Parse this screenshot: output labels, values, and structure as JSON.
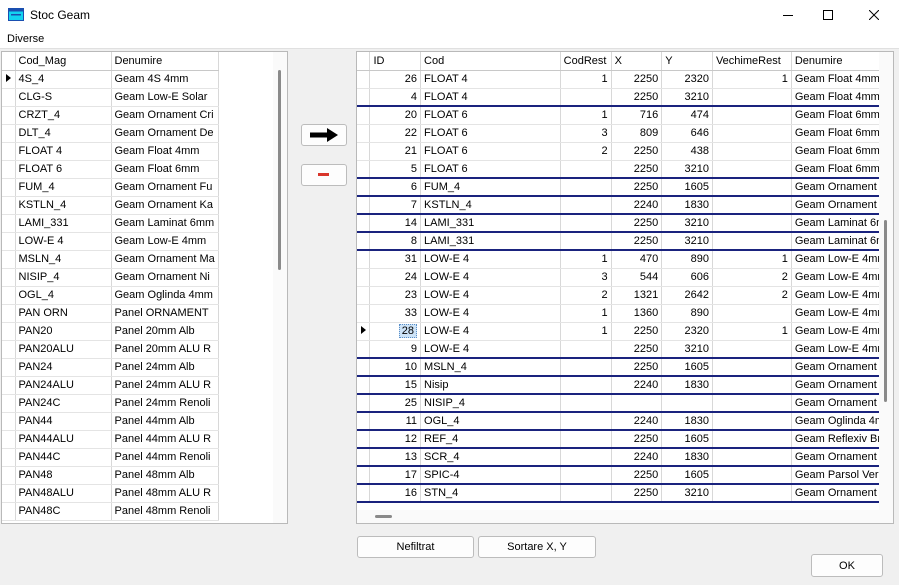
{
  "window": {
    "title": "Stoc Geam",
    "icon": "app-window-icon"
  },
  "menu": {
    "items": [
      {
        "label": "Diverse"
      }
    ]
  },
  "left_table": {
    "columns": [
      "Cod_Mag",
      "Denumire"
    ],
    "rows": [
      {
        "cod": "4S_4",
        "den": "Geam 4S 4mm"
      },
      {
        "cod": "CLG-S",
        "den": "Geam Low-E Solar"
      },
      {
        "cod": "CRZT_4",
        "den": "Geam Ornament Cri"
      },
      {
        "cod": "DLT_4",
        "den": "Geam Ornament De"
      },
      {
        "cod": "FLOAT 4",
        "den": "Geam Float 4mm"
      },
      {
        "cod": "FLOAT 6",
        "den": "Geam Float 6mm"
      },
      {
        "cod": "FUM_4",
        "den": "Geam Ornament Fu"
      },
      {
        "cod": "KSTLN_4",
        "den": "Geam Ornament Ka"
      },
      {
        "cod": "LAMI_331",
        "den": "Geam Laminat 6mm"
      },
      {
        "cod": "LOW-E 4",
        "den": "Geam Low-E 4mm"
      },
      {
        "cod": "MSLN_4",
        "den": "Geam Ornament Ma"
      },
      {
        "cod": "NISIP_4",
        "den": "Geam Ornament Ni"
      },
      {
        "cod": "OGL_4",
        "den": "Geam Oglinda 4mm"
      },
      {
        "cod": "PAN ORN",
        "den": "Panel ORNAMENT"
      },
      {
        "cod": "PAN20",
        "den": "Panel 20mm Alb"
      },
      {
        "cod": "PAN20ALU",
        "den": "Panel 20mm ALU R"
      },
      {
        "cod": "PAN24",
        "den": "Panel 24mm Alb"
      },
      {
        "cod": "PAN24ALU",
        "den": "Panel 24mm ALU R"
      },
      {
        "cod": "PAN24C",
        "den": "Panel 24mm Renoli"
      },
      {
        "cod": "PAN44",
        "den": "Panel 44mm Alb"
      },
      {
        "cod": "PAN44ALU",
        "den": "Panel 44mm ALU R"
      },
      {
        "cod": "PAN44C",
        "den": "Panel 44mm Renoli"
      },
      {
        "cod": "PAN48",
        "den": "Panel 48mm Alb"
      },
      {
        "cod": "PAN48ALU",
        "den": "Panel 48mm ALU R"
      },
      {
        "cod": "PAN48C",
        "den": "Panel 48mm Renoli"
      }
    ]
  },
  "right_table": {
    "columns": [
      "ID",
      "Cod",
      "CodRest",
      "X",
      "Y",
      "VechimeRest",
      "Denumire"
    ],
    "rows": [
      {
        "id": "26",
        "cod": "FLOAT 4",
        "codrest": "1",
        "x": "2250",
        "y": "2320",
        "vechime": "1",
        "den": "Geam Float 4mm"
      },
      {
        "id": "4",
        "cod": "FLOAT 4",
        "codrest": "",
        "x": "2250",
        "y": "3210",
        "vechime": "",
        "den": "Geam Float 4mm"
      },
      {
        "id": "20",
        "cod": "FLOAT 6",
        "codrest": "1",
        "x": "716",
        "y": "474",
        "vechime": "",
        "den": "Geam Float 6mm"
      },
      {
        "id": "22",
        "cod": "FLOAT 6",
        "codrest": "3",
        "x": "809",
        "y": "646",
        "vechime": "",
        "den": "Geam Float 6mm"
      },
      {
        "id": "21",
        "cod": "FLOAT 6",
        "codrest": "2",
        "x": "2250",
        "y": "438",
        "vechime": "",
        "den": "Geam Float 6mm"
      },
      {
        "id": "5",
        "cod": "FLOAT 6",
        "codrest": "",
        "x": "2250",
        "y": "3210",
        "vechime": "",
        "den": "Geam Float 6mm"
      },
      {
        "id": "6",
        "cod": "FUM_4",
        "codrest": "",
        "x": "2250",
        "y": "1605",
        "vechime": "",
        "den": "Geam Ornament F"
      },
      {
        "id": "7",
        "cod": "KSTLN_4",
        "codrest": "",
        "x": "2240",
        "y": "1830",
        "vechime": "",
        "den": "Geam Ornament K"
      },
      {
        "id": "14",
        "cod": "LAMI_331",
        "codrest": "",
        "x": "2250",
        "y": "3210",
        "vechime": "",
        "den": "Geam Laminat 6n"
      },
      {
        "id": "8",
        "cod": "LAMI_331",
        "codrest": "",
        "x": "2250",
        "y": "3210",
        "vechime": "",
        "den": "Geam Laminat 6n"
      },
      {
        "id": "31",
        "cod": "LOW-E 4",
        "codrest": "1",
        "x": "470",
        "y": "890",
        "vechime": "1",
        "den": "Geam Low-E 4mr"
      },
      {
        "id": "24",
        "cod": "LOW-E 4",
        "codrest": "3",
        "x": "544",
        "y": "606",
        "vechime": "2",
        "den": "Geam Low-E 4mr"
      },
      {
        "id": "23",
        "cod": "LOW-E 4",
        "codrest": "2",
        "x": "1321",
        "y": "2642",
        "vechime": "2",
        "den": "Geam Low-E 4mr"
      },
      {
        "id": "33",
        "cod": "LOW-E 4",
        "codrest": "1",
        "x": "1360",
        "y": "890",
        "vechime": "",
        "den": "Geam Low-E 4mr"
      },
      {
        "id": "28",
        "cod": "LOW-E 4",
        "codrest": "1",
        "x": "2250",
        "y": "2320",
        "vechime": "1",
        "den": "Geam Low-E 4mr"
      },
      {
        "id": "9",
        "cod": "LOW-E 4",
        "codrest": "",
        "x": "2250",
        "y": "3210",
        "vechime": "",
        "den": "Geam Low-E 4mr"
      },
      {
        "id": "10",
        "cod": "MSLN_4",
        "codrest": "",
        "x": "2250",
        "y": "1605",
        "vechime": "",
        "den": "Geam Ornament M"
      },
      {
        "id": "15",
        "cod": "Nisip",
        "codrest": "",
        "x": "2240",
        "y": "1830",
        "vechime": "",
        "den": "Geam Ornament N"
      },
      {
        "id": "25",
        "cod": "NISIP_4",
        "codrest": "",
        "x": "",
        "y": "",
        "vechime": "",
        "den": "Geam Ornament N"
      },
      {
        "id": "11",
        "cod": "OGL_4",
        "codrest": "",
        "x": "2240",
        "y": "1830",
        "vechime": "",
        "den": "Geam Oglinda 4m"
      },
      {
        "id": "12",
        "cod": "REF_4",
        "codrest": "",
        "x": "2250",
        "y": "1605",
        "vechime": "",
        "den": "Geam Reflexiv Br"
      },
      {
        "id": "13",
        "cod": "SCR_4",
        "codrest": "",
        "x": "2240",
        "y": "1830",
        "vechime": "",
        "den": "Geam Ornament S"
      },
      {
        "id": "17",
        "cod": "SPIC-4",
        "codrest": "",
        "x": "2250",
        "y": "1605",
        "vechime": "",
        "den": "Geam Parsol Ver"
      },
      {
        "id": "16",
        "cod": "STN_4",
        "codrest": "",
        "x": "2250",
        "y": "3210",
        "vechime": "",
        "den": "Geam Ornament S"
      }
    ]
  },
  "buttons": {
    "add_icon": "arrow-right-icon",
    "remove_icon": "minus-icon",
    "nefiltrat": "Nefiltrat",
    "sortare": "Sortare X, Y",
    "ok": "OK"
  },
  "colors": {
    "separator": "#1a237e",
    "remove": "#d9362b",
    "selection": "#cde3f7"
  }
}
